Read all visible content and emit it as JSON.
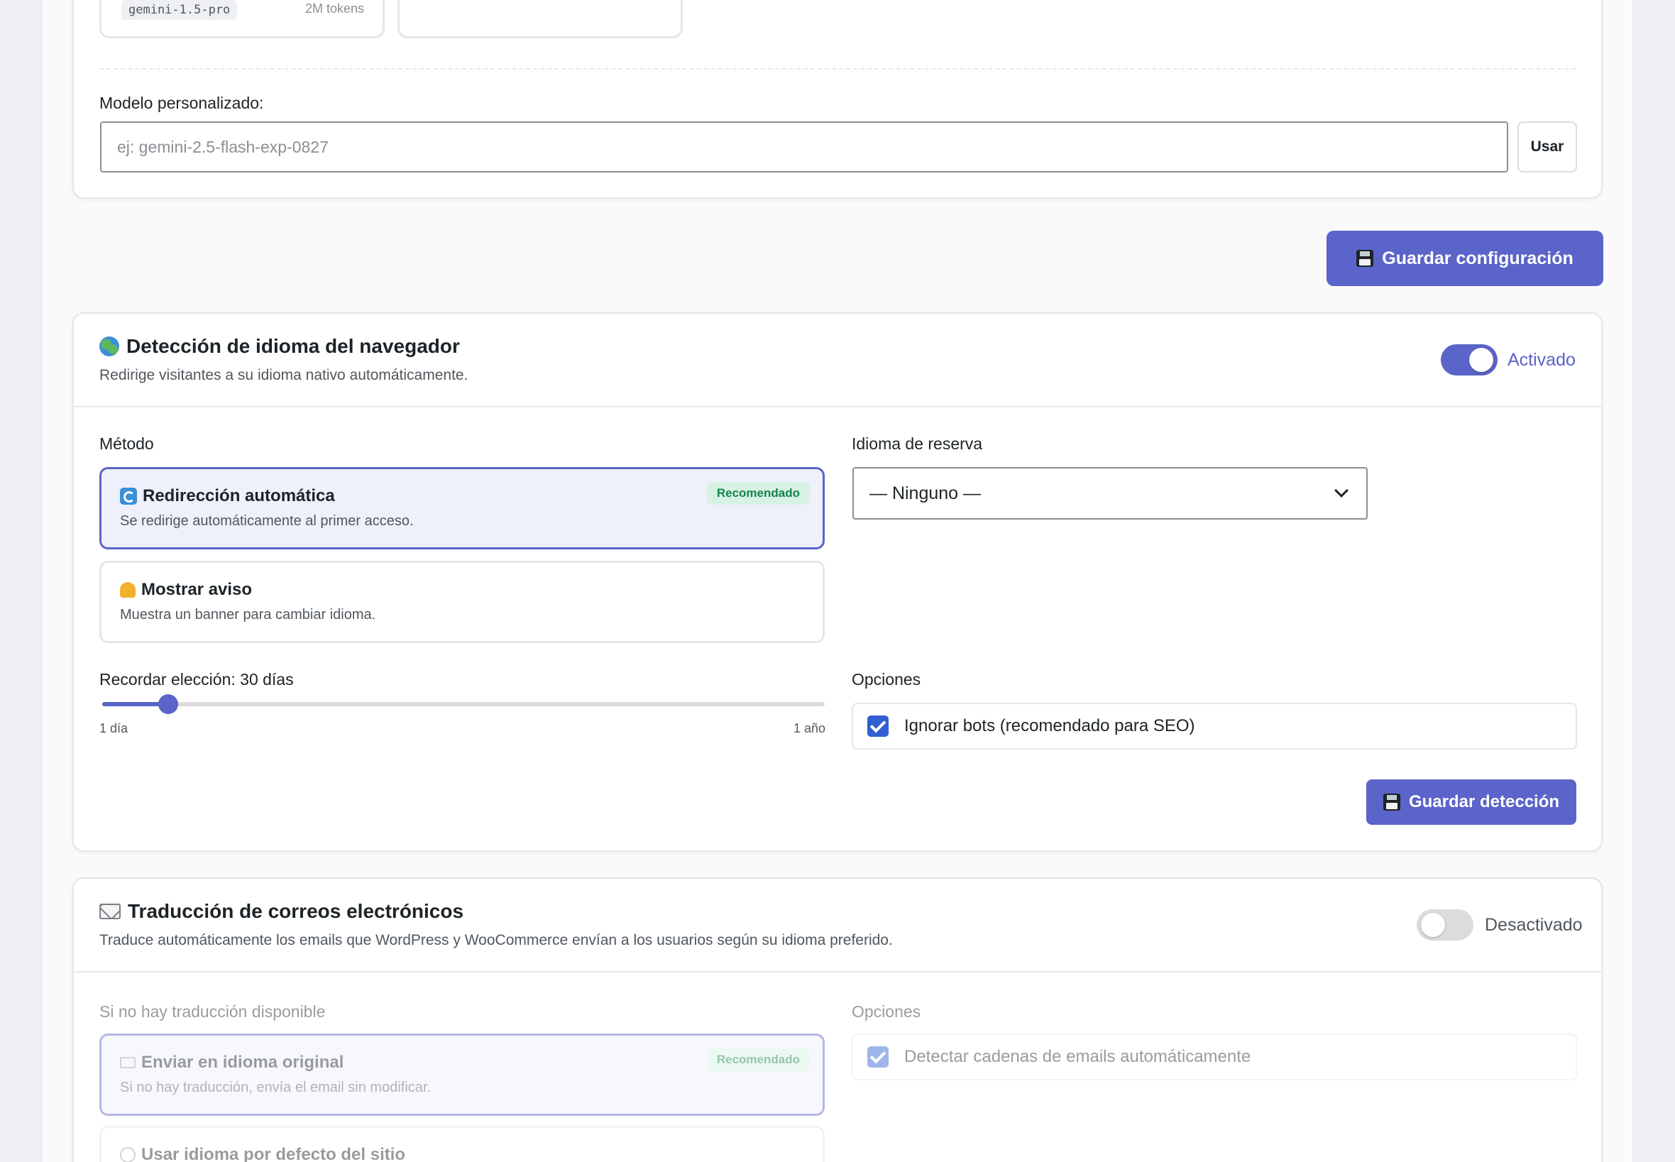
{
  "model_cards": [
    {
      "code": "gemini-1.5-pro",
      "tokens": "2M tokens"
    },
    {
      "code": "",
      "tokens": ""
    }
  ],
  "custom_model": {
    "label": "Modelo personalizado:",
    "placeholder": "ej: gemini-2.5-flash-exp-0827",
    "use_button": "Usar"
  },
  "save_config_button": "Guardar configuración",
  "detection": {
    "title": "Detección de idioma del navegador",
    "subtitle": "Redirige visitantes a su idioma nativo automáticamente.",
    "toggle_state": "Activado",
    "method_label": "Método",
    "methods": [
      {
        "title": "Redirección automática",
        "desc": "Se redirige automáticamente al primer acceso.",
        "badge": "Recomendado",
        "selected": true
      },
      {
        "title": "Mostrar aviso",
        "desc": "Muestra un banner para cambiar idioma.",
        "selected": false
      }
    ],
    "fallback_label": "Idioma de reserva",
    "fallback_value": "— Ninguno —",
    "remember_label": "Recordar elección: 30 días",
    "remember_value_days": 30,
    "slider_fill_fraction": 0.09,
    "slider_min": "1 día",
    "slider_max": "1 año",
    "options_label": "Opciones",
    "option_ignore_bots": "Ignorar bots (recomendado para SEO)",
    "save_button": "Guardar detección"
  },
  "emails": {
    "title": "Traducción de correos electrónicos",
    "subtitle": "Traduce automáticamente los emails que WordPress y WooCommerce envían a los usuarios según su idioma preferido.",
    "toggle_state": "Desactivado",
    "no_translation_label": "Si no hay traducción disponible",
    "methods": [
      {
        "title": "Enviar en idioma original",
        "desc": "Si no hay traducción, envía el email sin modificar.",
        "badge": "Recomendado",
        "selected": true
      },
      {
        "title": "Usar idioma por defecto del sitio",
        "desc": "",
        "selected": false
      }
    ],
    "options_label": "Opciones",
    "option_detect": "Detectar cadenas de emails automáticamente"
  },
  "colors": {
    "primary": "#5b64c8",
    "badge_bg": "#d7f2e3",
    "badge_text": "#14834a",
    "checkbox": "#2f5fd0"
  }
}
